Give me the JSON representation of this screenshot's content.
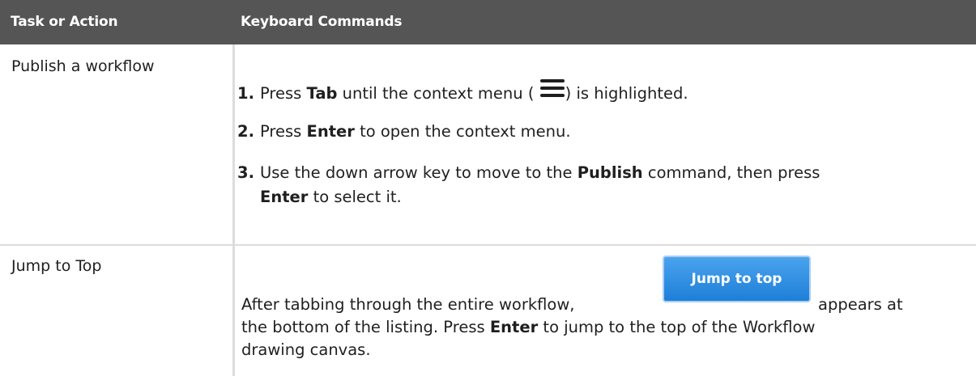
{
  "header": {
    "col1": "Task or Action",
    "col2": "Keyboard Commands"
  },
  "rows": [
    {
      "task": "Publish a workflow",
      "steps": [
        {
          "num": "1.",
          "pre": "Press ",
          "key": "Tab",
          "mid": " until the context menu (",
          "post": ") is highlighted."
        },
        {
          "num": "2.",
          "pre": "Press ",
          "key": "Enter",
          "post": " to open the context menu."
        },
        {
          "num": "3.",
          "pre": "Use the down arrow key to move to the ",
          "key": "Publish",
          "post": " command, then press",
          "key2": "Enter",
          "post2": " to select it."
        }
      ],
      "icon": "hamburger-menu-icon"
    },
    {
      "task": "Jump to Top",
      "pre": "After tabbing through the entire workflow,",
      "button": "Jump to top",
      "post": "appears at",
      "line2_pre": "the bottom of the listing. Press ",
      "line2_key": "Enter",
      "line2_post": " to jump to the top of the Workflow",
      "line3": "drawing canvas."
    }
  ],
  "colors": {
    "header_bg": "#555555",
    "button_bg": "#2f8fe3",
    "divider": "#dcdcdc"
  }
}
